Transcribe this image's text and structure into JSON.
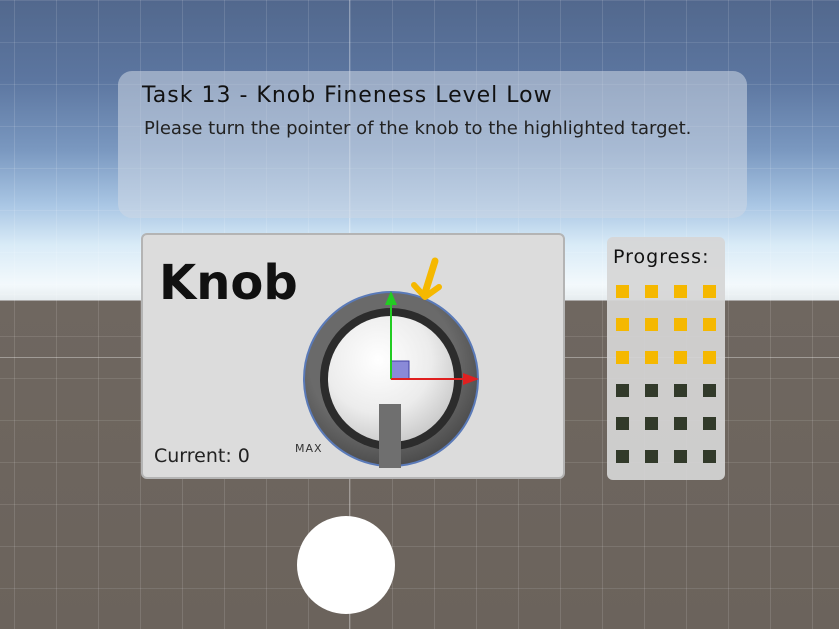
{
  "instruction": {
    "title": "Task 13 - Knob Fineness Level Low",
    "description": "Please turn the pointer of the knob to the highlighted target."
  },
  "knob_panel": {
    "title": "Knob",
    "current_label": "Current: 0",
    "max_label": "MAX"
  },
  "progress": {
    "label": "Progress:",
    "total_steps": 24,
    "completed_steps": 12,
    "columns": 4,
    "done_color": "#f5b800",
    "todo_color": "#323a2a"
  },
  "colors": {
    "target_marker": "#f5b800",
    "gizmo_y_axis": "#22cc22",
    "gizmo_x_axis": "#e02020",
    "gizmo_center": "#8a8ad8"
  },
  "icons": {
    "target": "target-arrow-icon",
    "pointer": "knob-pointer"
  }
}
